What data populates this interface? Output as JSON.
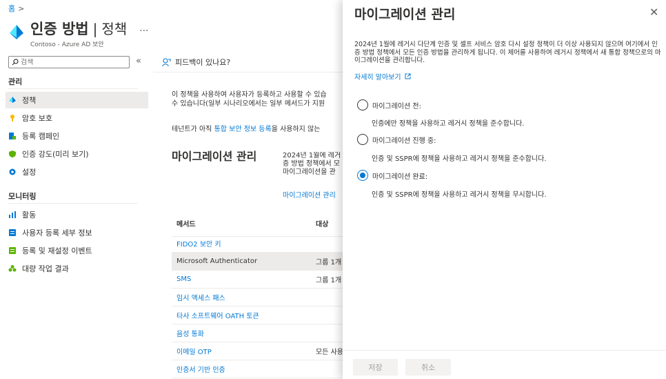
{
  "breadcrumb": {
    "home": "홈",
    "sep": ">"
  },
  "header": {
    "title": "인증 방법",
    "separator": "|",
    "subtitle_title": "정책",
    "more": "···",
    "org": "Contoso - Azure AD 보안"
  },
  "search": {
    "placeholder": "검색",
    "collapse": "«"
  },
  "nav": {
    "manage_label": "관리",
    "manage_items": [
      {
        "label": "정책"
      },
      {
        "label": "암호 보호"
      },
      {
        "label": "등록 캠페인"
      },
      {
        "label": "인증 강도(미리 보기)"
      },
      {
        "label": "설정"
      }
    ],
    "monitor_label": "모니터링",
    "monitor_items": [
      {
        "label": "활동"
      },
      {
        "label": "사용자 등록 세부 정보"
      },
      {
        "label": "등록 및 재설정 이벤트"
      },
      {
        "label": "대량 작업 결과"
      }
    ]
  },
  "main": {
    "feedback": "피드백이 있나요?",
    "desc_line1": "이 정책을 사용하여 사용자가 등록하고 사용할 수 있습",
    "desc_line2": "수 있습니다(일부 시나리오에서는 일부 메서드가 지원",
    "desc2_pre": "테넌트가 아직 ",
    "desc2_link": "통합 보안 정보 등록",
    "desc2_post": "을 사용하지 않는",
    "mig_heading": "마이그레이션 관리",
    "mig_desc_1": "2024년 1월에 레거",
    "mig_desc_2": "증 방법 정책에서 모",
    "mig_desc_3": "마이그레이션을 관",
    "mig_link": "마이그레이션 관리",
    "table": {
      "col_method": "메서드",
      "col_target": "대상",
      "rows": [
        {
          "method": "FIDO2 보안 키",
          "target": ""
        },
        {
          "method": "Microsoft Authenticator",
          "target": "그룹 1개"
        },
        {
          "method": "SMS",
          "target": "그룹 1개"
        },
        {
          "method": "임시 액세스 패스",
          "target": ""
        },
        {
          "method": "타사 소프트웨어 OATH 토큰",
          "target": ""
        },
        {
          "method": "음성 통화",
          "target": ""
        },
        {
          "method": "이메일 OTP",
          "target": "모든 사용자"
        },
        {
          "method": "인증서 기반 인증",
          "target": ""
        }
      ]
    }
  },
  "panel": {
    "title": "마이그레이션 관리",
    "close": "✕",
    "desc": "2024년 1월에 레거시 다단계 인증 및 셀프 서비스 암호 다시 설정 정책이 더 이상 사용되지 않으며 여기에서 인증 방법 정책에서 모든 인증 방법을 관리하게 됩니다. 이 제어를 사용하여 레거시 정책에서 새 통합 정책으로의 마이그레이션을 관리합니다.",
    "learn_more": "자세히 알아보기",
    "options": [
      {
        "label": "마이그레이션 전:",
        "desc": "인증에만 정책을 사용하고 레거시 정책을 준수합니다.",
        "selected": false
      },
      {
        "label": "마이그레이션 진행 중:",
        "desc": "인증 및 SSPR에 정책을 사용하고 레거시 정책을 준수합니다.",
        "selected": false
      },
      {
        "label": "마이그레이션 완료:",
        "desc": "인증 및 SSPR에 정책을 사용하고 레거시 정책을 무시합니다.",
        "selected": true
      }
    ],
    "save": "저장",
    "cancel": "취소"
  },
  "colors": {
    "accent": "#0078d4",
    "text": "#323130",
    "muted": "#605e5c",
    "hover": "#edebe9"
  }
}
